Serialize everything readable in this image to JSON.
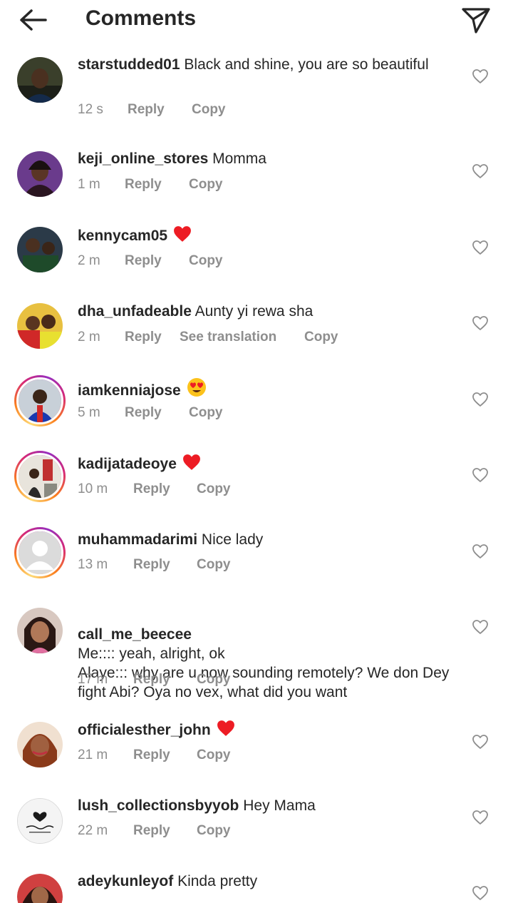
{
  "header": {
    "title": "Comments",
    "back_icon": "arrow-left-icon",
    "share_icon": "paper-plane-icon"
  },
  "labels": {
    "reply": "Reply",
    "copy": "Copy",
    "see_translation": "See translation"
  },
  "comments": [
    {
      "username": "starstudded01",
      "text": "Black and shine, you are so beautiful",
      "time": "12 s",
      "emoji": ""
    },
    {
      "username": "keji_online_stores",
      "text": "Momma",
      "time": "1 m",
      "emoji": ""
    },
    {
      "username": "kennycam05",
      "text": "",
      "time": "2 m",
      "emoji": "red-heart"
    },
    {
      "username": "dha_unfadeable",
      "text": "Aunty yi rewa sha",
      "time": "2 m",
      "emoji": ""
    },
    {
      "username": "iamkenniajose",
      "text": "",
      "time": "5 m",
      "emoji": "heart-eyes"
    },
    {
      "username": "kadijatadeoye",
      "text": "",
      "time": "10 m",
      "emoji": "red-heart"
    },
    {
      "username": "muhammadarimi",
      "text": "Nice lady",
      "time": "13 m",
      "emoji": ""
    },
    {
      "username": "call_me_beecee",
      "text": "Me:::: yeah, alright, ok\nAlaye::: why are u now sounding remotely? We don Dey fight Abi? Oya no vex, what did you want",
      "time": "17 m",
      "emoji": ""
    },
    {
      "username": "officialesther_john",
      "text": "",
      "time": "21 m",
      "emoji": "red-heart"
    },
    {
      "username": "lush_collectionsbyyob",
      "text": "Hey Mama",
      "time": "22 m",
      "emoji": ""
    },
    {
      "username": "adeykunleyof",
      "text": "Kinda pretty",
      "time": "",
      "emoji": ""
    }
  ],
  "colors": {
    "text": "#262626",
    "secondary": "#8e8e8e",
    "heart_red": "#ed1c24"
  }
}
